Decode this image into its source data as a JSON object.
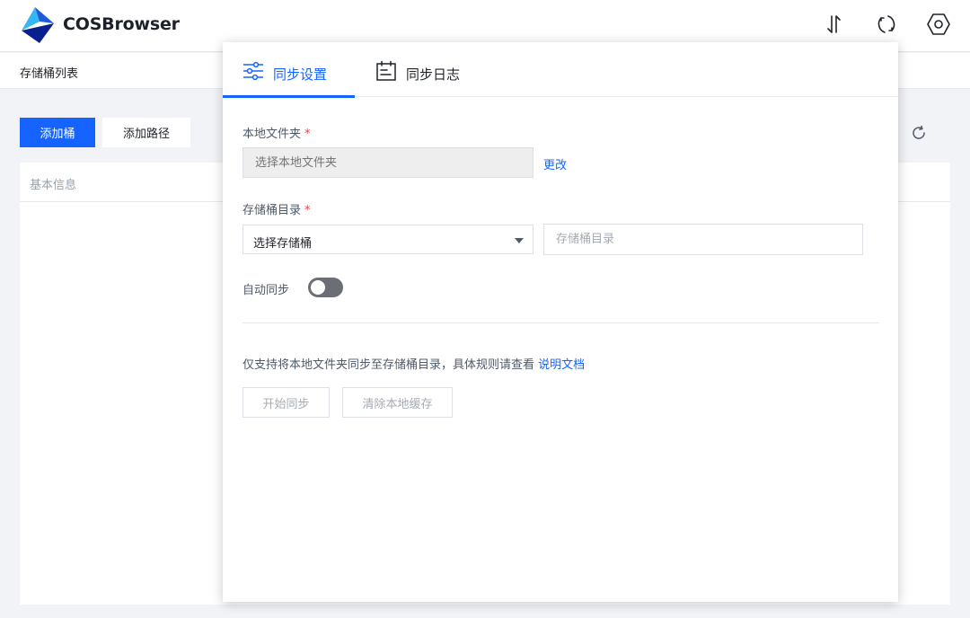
{
  "app": {
    "brand": "COSBrowser",
    "colors": {
      "accent": "#1664ff",
      "logo_dark": "#0a1f8f",
      "logo_light": "#35b6f5"
    }
  },
  "header": {
    "icons": [
      "transfer-icon",
      "sync-icon",
      "settings-icon"
    ]
  },
  "subheader": {
    "title": "存储桶列表"
  },
  "toolbar": {
    "add_bucket_label": "添加桶",
    "add_path_label": "添加路径",
    "refresh_icon": "refresh-icon"
  },
  "table": {
    "column_basic_info": "基本信息"
  },
  "sync_panel": {
    "tabs": [
      {
        "label": "同步设置",
        "icon": "sliders-icon",
        "active": true
      },
      {
        "label": "同步日志",
        "icon": "calendar-log-icon",
        "active": false
      }
    ],
    "local_folder": {
      "label": "本地文件夹",
      "required_mark": "*",
      "placeholder": "选择本地文件夹",
      "change_label": "更改"
    },
    "bucket_dir": {
      "label": "存储桶目录",
      "required_mark": "*",
      "select_value": "选择存储桶",
      "dir_placeholder": "存储桶目录"
    },
    "auto_sync": {
      "label": "自动同步",
      "enabled": false
    },
    "note": {
      "text": "仅支持将本地文件夹同步至存储桶目录，具体规则请查看 ",
      "link": "说明文档"
    },
    "buttons": {
      "start_label": "开始同步",
      "clear_label": "清除本地缓存"
    }
  }
}
